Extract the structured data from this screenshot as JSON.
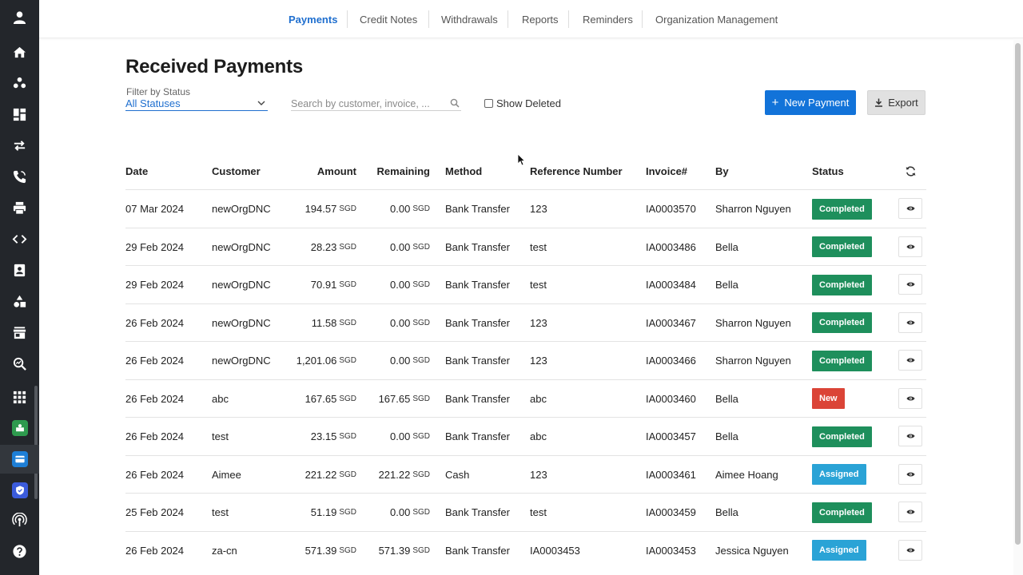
{
  "sidebar": {
    "items": [
      {
        "icon": "user-avatar-icon",
        "kind": "plain"
      },
      {
        "icon": "home-icon",
        "kind": "plain"
      },
      {
        "icon": "users-group-icon",
        "kind": "plain"
      },
      {
        "icon": "dashboard-icon",
        "kind": "plain"
      },
      {
        "icon": "transfer-arrows-icon",
        "kind": "plain"
      },
      {
        "icon": "phone-icon",
        "kind": "plain"
      },
      {
        "icon": "printer-icon",
        "kind": "plain"
      },
      {
        "icon": "code-icon",
        "kind": "plain"
      },
      {
        "icon": "contacts-icon",
        "kind": "plain"
      },
      {
        "icon": "shapes-icon",
        "kind": "plain"
      },
      {
        "icon": "store-icon",
        "kind": "plain"
      },
      {
        "icon": "search-analytics-icon",
        "kind": "plain"
      },
      {
        "icon": "apps-grid-icon",
        "kind": "plain"
      },
      {
        "icon": "green-app-icon",
        "kind": "app",
        "color": "#2e9a4e"
      },
      {
        "icon": "payments-app-icon",
        "kind": "app",
        "color": "#1e7fd6"
      },
      {
        "icon": "shield-app-icon",
        "kind": "app",
        "color": "#3b5bdb"
      },
      {
        "icon": "broadcast-icon",
        "kind": "plain"
      },
      {
        "icon": "help-icon",
        "kind": "plain"
      }
    ]
  },
  "nav": {
    "tabs": [
      {
        "label": "Payments",
        "active": true
      },
      {
        "label": "Credit Notes",
        "active": false
      },
      {
        "label": "Withdrawals",
        "active": false
      },
      {
        "label": "Reports",
        "active": false
      },
      {
        "label": "Reminders",
        "active": false
      },
      {
        "label": "Organization Management",
        "active": false
      }
    ]
  },
  "page": {
    "title": "Received Payments",
    "filter_label": "Filter by Status",
    "filter_value": "All Statuses",
    "search_placeholder": "Search by customer, invoice, ...",
    "search_value": "",
    "show_deleted_label": "Show Deleted",
    "new_payment_label": "New Payment",
    "export_label": "Export"
  },
  "table": {
    "headers": {
      "date": "Date",
      "customer": "Customer",
      "amount": "Amount",
      "remaining": "Remaining",
      "method": "Method",
      "reference": "Reference Number",
      "invoice": "Invoice#",
      "by": "By",
      "status": "Status"
    },
    "status_colors": {
      "Completed": "#1e8f5c",
      "New": "#db4437",
      "Assigned": "#2aa3d6"
    },
    "rows": [
      {
        "date": "07 Mar 2024",
        "customer": "newOrgDNC",
        "amount": "194.57",
        "amount_cur": "SGD",
        "remaining": "0.00",
        "remaining_cur": "SGD",
        "method": "Bank Transfer",
        "reference": "123",
        "invoice": "IA0003570",
        "by": "Sharron Nguyen",
        "status": "Completed"
      },
      {
        "date": "29 Feb 2024",
        "customer": "newOrgDNC",
        "amount": "28.23",
        "amount_cur": "SGD",
        "remaining": "0.00",
        "remaining_cur": "SGD",
        "method": "Bank Transfer",
        "reference": "test",
        "invoice": "IA0003486",
        "by": "Bella",
        "status": "Completed"
      },
      {
        "date": "29 Feb 2024",
        "customer": "newOrgDNC",
        "amount": "70.91",
        "amount_cur": "SGD",
        "remaining": "0.00",
        "remaining_cur": "SGD",
        "method": "Bank Transfer",
        "reference": "test",
        "invoice": "IA0003484",
        "by": "Bella",
        "status": "Completed"
      },
      {
        "date": "26 Feb 2024",
        "customer": "newOrgDNC",
        "amount": "11.58",
        "amount_cur": "SGD",
        "remaining": "0.00",
        "remaining_cur": "SGD",
        "method": "Bank Transfer",
        "reference": "123",
        "invoice": "IA0003467",
        "by": "Sharron Nguyen",
        "status": "Completed"
      },
      {
        "date": "26 Feb 2024",
        "customer": "newOrgDNC",
        "amount": "1,201.06",
        "amount_cur": "SGD",
        "remaining": "0.00",
        "remaining_cur": "SGD",
        "method": "Bank Transfer",
        "reference": "123",
        "invoice": "IA0003466",
        "by": "Sharron Nguyen",
        "status": "Completed"
      },
      {
        "date": "26 Feb 2024",
        "customer": "abc",
        "amount": "167.65",
        "amount_cur": "SGD",
        "remaining": "167.65",
        "remaining_cur": "SGD",
        "method": "Bank Transfer",
        "reference": "abc",
        "invoice": "IA0003460",
        "by": "Bella",
        "status": "New"
      },
      {
        "date": "26 Feb 2024",
        "customer": "test",
        "amount": "23.15",
        "amount_cur": "SGD",
        "remaining": "0.00",
        "remaining_cur": "SGD",
        "method": "Bank Transfer",
        "reference": "abc",
        "invoice": "IA0003457",
        "by": "Bella",
        "status": "Completed"
      },
      {
        "date": "26 Feb 2024",
        "customer": "Aimee",
        "amount": "221.22",
        "amount_cur": "SGD",
        "remaining": "221.22",
        "remaining_cur": "SGD",
        "method": "Cash",
        "reference": "123",
        "invoice": "IA0003461",
        "by": "Aimee Hoang",
        "status": "Assigned"
      },
      {
        "date": "25 Feb 2024",
        "customer": "test",
        "amount": "51.19",
        "amount_cur": "SGD",
        "remaining": "0.00",
        "remaining_cur": "SGD",
        "method": "Bank Transfer",
        "reference": "test",
        "invoice": "IA0003459",
        "by": "Bella",
        "status": "Completed"
      },
      {
        "date": "26 Feb 2024",
        "customer": "za-cn",
        "amount": "571.39",
        "amount_cur": "SGD",
        "remaining": "571.39",
        "remaining_cur": "SGD",
        "method": "Bank Transfer",
        "reference": "IA0003453",
        "invoice": "IA0003453",
        "by": "Jessica Nguyen",
        "status": "Assigned"
      }
    ]
  }
}
